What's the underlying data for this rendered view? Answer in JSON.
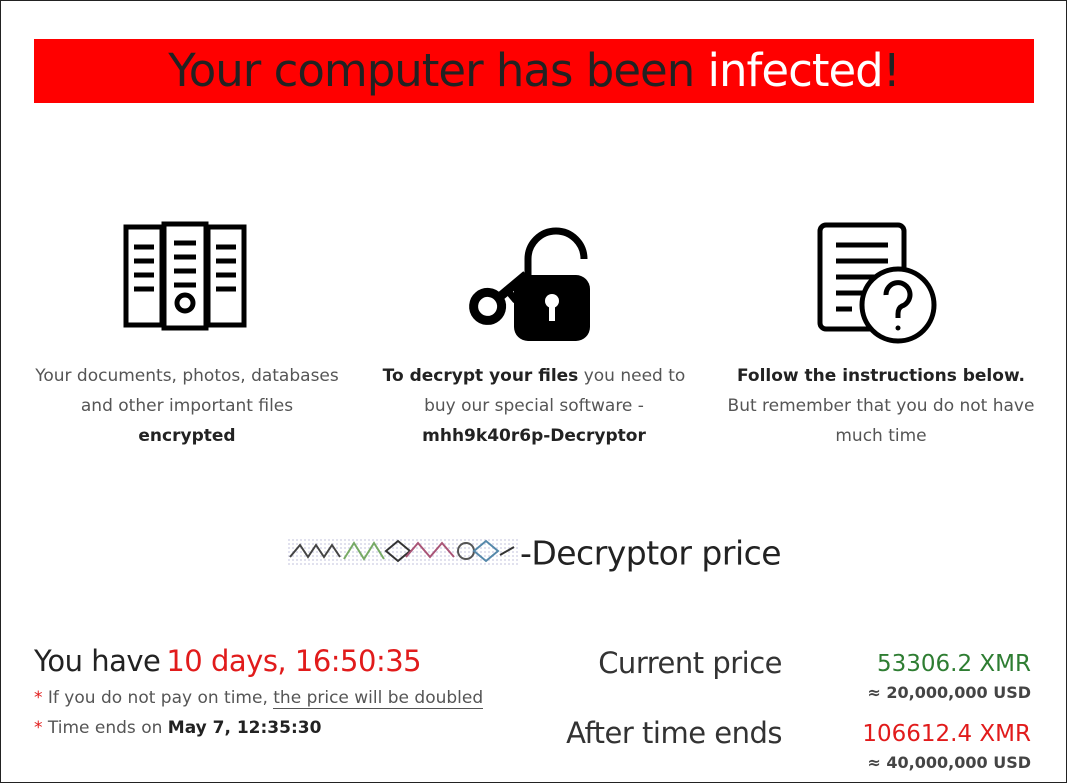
{
  "banner": {
    "title_part1": "Your computer has been ",
    "title_highlight": "infected",
    "title_exclaim": "!"
  },
  "features": [
    {
      "icon": "file-cabinet-icon",
      "text_plain": "Your documents, photos, databases and other important files",
      "text_bold": "encrypted"
    },
    {
      "icon": "key-lock-icon",
      "text_bold_start": "To decrypt your files",
      "text_plain": " you need to buy our special software - ",
      "text_bold_end": "mhh9k40r6p-Decryptor"
    },
    {
      "icon": "document-question-icon",
      "text_bold": "Follow the instructions below.",
      "text_plain": " But remember that you do not have much time"
    }
  ],
  "price_section": {
    "title_suffix": "-Decryptor price"
  },
  "countdown": {
    "label": "You have",
    "time_left": "10 days, 16:50:35",
    "note1_star": "*",
    "note1_text": " If you do not pay on time, ",
    "note1_link": "the price will be doubled",
    "note2_star": "*",
    "note2_text": " Time ends on ",
    "note2_date": "May 7, 12:35:30"
  },
  "prices": {
    "current_label": "Current price",
    "current_amount": "53306.2",
    "current_currency": "XMR",
    "current_usd": "≈ 20,000,000 USD",
    "after_label": "After time ends",
    "after_amount": "106612.4",
    "after_currency": "XMR",
    "after_usd": "≈ 40,000,000 USD"
  }
}
